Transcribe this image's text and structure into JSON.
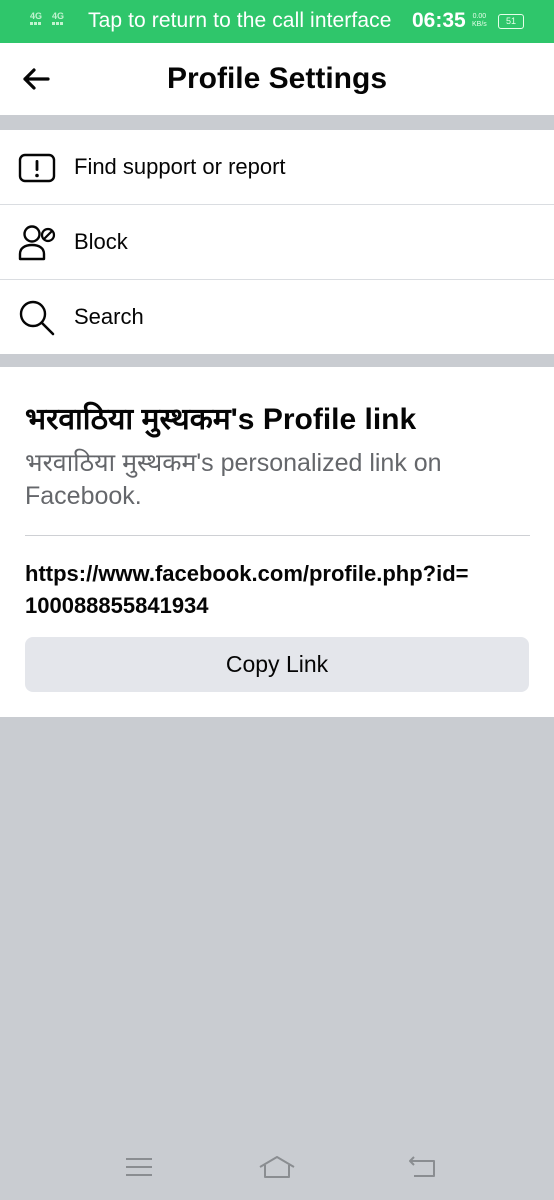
{
  "status_bar": {
    "signal_1": "4G",
    "signal_2": "4G",
    "call_banner": "Tap to return to the call interface",
    "time": "06:35",
    "speed_value": "0.00",
    "speed_unit": "KB/s",
    "battery": "51"
  },
  "header": {
    "title": "Profile Settings",
    "back_icon": "arrow-left-icon"
  },
  "menu": {
    "items": [
      {
        "label": "Find support or report",
        "icon": "report-exclamation-icon"
      },
      {
        "label": "Block",
        "icon": "block-person-icon"
      },
      {
        "label": "Search",
        "icon": "search-icon"
      }
    ]
  },
  "profile_link": {
    "title": "भरवाठिया मुस्थकम's Profile link",
    "subtitle": "भरवाठिया मुस्थकम's personalized link on Facebook.",
    "url_line_1": "https://www.facebook.com/profile.php?id=",
    "url_line_2": "100088855841934",
    "copy_label": "Copy Link"
  },
  "nav_bar": {
    "buttons": [
      "menu-icon",
      "home-icon",
      "back-icon"
    ]
  },
  "colors": {
    "status_bar": "#2fc66b",
    "background": "#c9ccd1",
    "button": "#e4e6eb",
    "secondary_text": "#65676b"
  }
}
